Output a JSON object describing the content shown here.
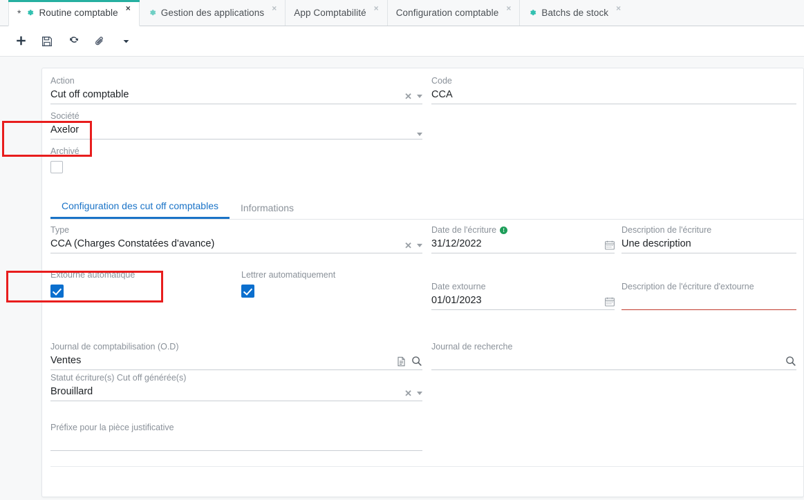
{
  "window": {
    "tabs": [
      {
        "label": "Routine comptable",
        "active": true,
        "dirty": "*",
        "icon": "gear-icon",
        "close": "×"
      },
      {
        "label": "Gestion des applications",
        "active": false,
        "dirty": "",
        "icon": "gear-icon",
        "close": "×"
      },
      {
        "label": "App Comptabilité",
        "active": false,
        "dirty": "",
        "icon": "",
        "close": "×"
      },
      {
        "label": "Configuration comptable",
        "active": false,
        "dirty": "",
        "icon": "",
        "close": "×"
      },
      {
        "label": "Batchs de stock",
        "active": false,
        "dirty": "",
        "icon": "gear-icon",
        "close": "×"
      }
    ]
  },
  "toolbar": {
    "buttons": [
      {
        "name": "new-record-button",
        "icon": "plus-icon"
      },
      {
        "name": "save-button",
        "icon": "save-floppy-icon"
      },
      {
        "name": "refresh-button",
        "icon": "refresh-icon"
      },
      {
        "name": "attachment-button",
        "icon": "paperclip-icon"
      },
      {
        "name": "more-menu-button",
        "icon": "chevron-down-icon"
      }
    ]
  },
  "form": {
    "action": {
      "label": "Action",
      "value": "Cut off comptable",
      "clear": "✕"
    },
    "code": {
      "label": "Code",
      "value": "CCA"
    },
    "societe": {
      "label": "Société",
      "value": "Axelor"
    },
    "archive": {
      "label": "Archivé",
      "checked": false
    }
  },
  "inner_tabs": [
    {
      "label": "Configuration des cut off comptables",
      "active": true
    },
    {
      "label": "Informations",
      "active": false
    }
  ],
  "config": {
    "type": {
      "label": "Type",
      "value": "CCA (Charges Constatées d'avance)",
      "clear": "✕"
    },
    "date_ecriture": {
      "label": "Date de l'écriture",
      "value": "31/12/2022",
      "badge": "!"
    },
    "description_ecriture": {
      "label": "Description de l'écriture",
      "value": "Une description"
    },
    "extourne_auto": {
      "label": "Extourne automatique",
      "checked": true
    },
    "lettrer_auto": {
      "label": "Lettrer automatiquement",
      "checked": true
    },
    "date_extourne": {
      "label": "Date extourne",
      "value": "01/01/2023"
    },
    "description_extourne": {
      "label": "Description de l'écriture d'extourne",
      "value": "",
      "error": true
    },
    "journal_comptabilisation": {
      "label": "Journal de comptabilisation (O.D)",
      "value": "Ventes"
    },
    "journal_recherche": {
      "label": "Journal de recherche",
      "value": ""
    },
    "statut_ecriture": {
      "label": "Statut écriture(s) Cut off générée(s)",
      "value": "Brouillard",
      "clear": "✕"
    },
    "prefixe": {
      "label": "Préfixe pour la pièce justificative",
      "value": ""
    }
  },
  "colors": {
    "accent_teal": "#26b0a1",
    "accent_blue": "#1a73c7",
    "checkbox_blue": "#0b6fce",
    "error_red": "#c0392b",
    "highlight_red": "#e81d1d",
    "info_green": "#1e9e5a"
  }
}
